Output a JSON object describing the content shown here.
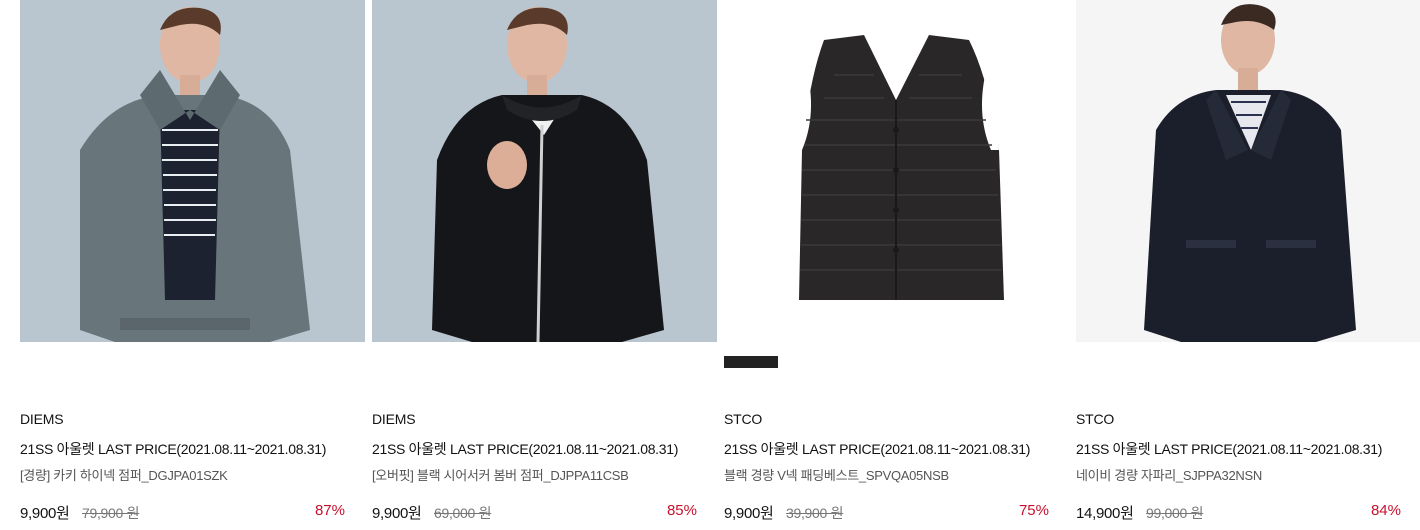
{
  "products": [
    {
      "brand": "DIEMS",
      "event": "21SS 아울렛 LAST PRICE(2021.08.11~2021.08.31)",
      "name": "[경량] 카키 하이넥 점퍼_DGJPA01SZK",
      "price": "9,900원",
      "original_price": "79,900 원",
      "discount": "87%",
      "image": "model-grey-highneck-jacket",
      "bg_color": "#b9c6cf",
      "garment_color": "#68757b"
    },
    {
      "brand": "DIEMS",
      "event": "21SS 아울렛 LAST PRICE(2021.08.11~2021.08.31)",
      "name": "[오버핏] 블랙 시어서커 봄버 점퍼_DJPPA11CSB",
      "price": "9,900원",
      "original_price": "69,000 원",
      "discount": "85%",
      "image": "model-black-bomber-jacket",
      "bg_color": "#b9c6cf",
      "garment_color": "#15161a"
    },
    {
      "brand": "STCO",
      "event": "21SS 아울렛 LAST PRICE(2021.08.11~2021.08.31)",
      "name": "블랙 경량 V넥 패딩베스트_SPVQA05NSB",
      "price": "9,900원",
      "original_price": "39,900 원",
      "discount": "75%",
      "image": "black-padded-vest",
      "bg_color": "#ffffff",
      "garment_color": "#2a2728"
    },
    {
      "brand": "STCO",
      "event": "21SS 아울렛 LAST PRICE(2021.08.11~2021.08.31)",
      "name": "네이비 경량 자파리_SJPPA32NSN",
      "price": "14,900원",
      "original_price": "99,000 원",
      "discount": "84%",
      "image": "model-navy-jacket",
      "bg_color": "#f5f5f5",
      "garment_color": "#1b1f2b"
    }
  ]
}
